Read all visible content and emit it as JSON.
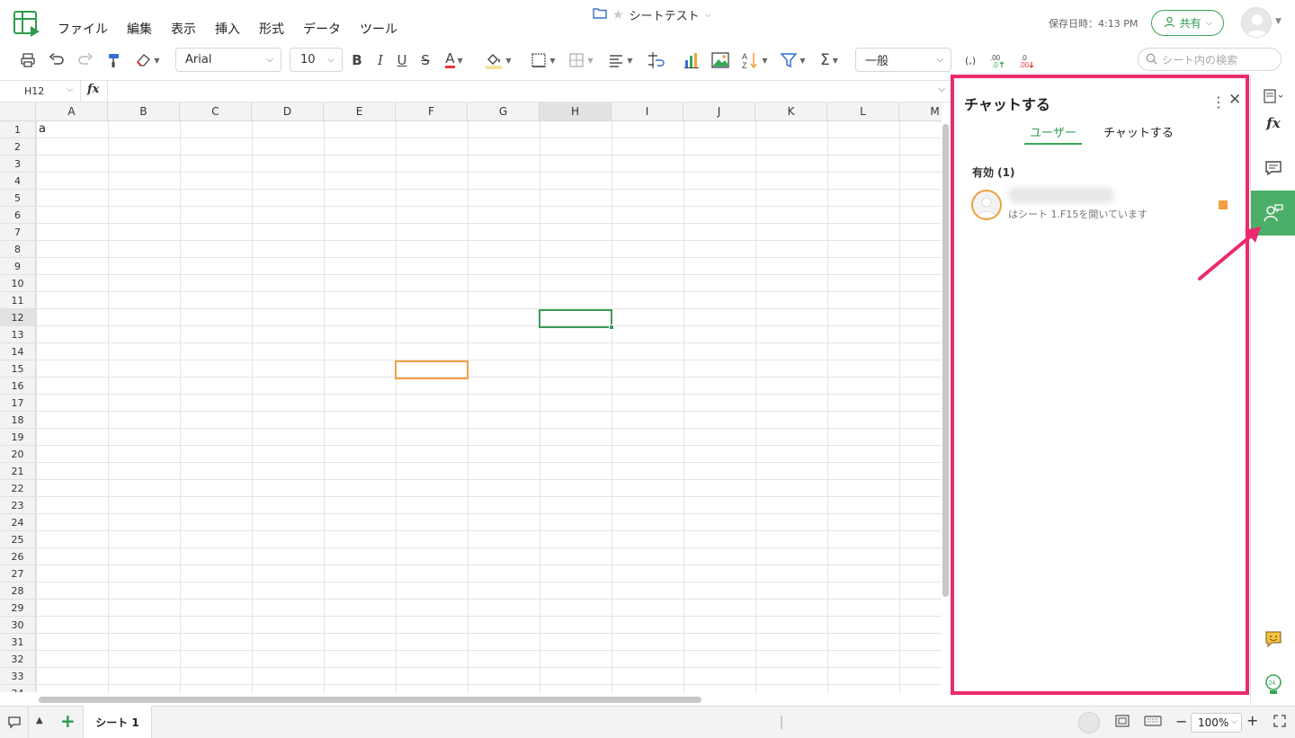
{
  "menu": [
    "ファイル",
    "編集",
    "表示",
    "挿入",
    "形式",
    "データ",
    "ツール"
  ],
  "document": {
    "title": "シートテスト",
    "saved_time": "保存日時：4:13 PM"
  },
  "header": {
    "share_label": "共有"
  },
  "toolbar": {
    "font": "Arial",
    "font_size": "10",
    "bold": "B",
    "italic": "I",
    "underline": "U",
    "strike": "S",
    "font_color_letter": "A",
    "number_format": "一般",
    "search_placeholder": "シート内の検索",
    "accent_color": "#3aa757",
    "font_color": "#e53935"
  },
  "formula_bar": {
    "cell_ref": "H12",
    "fx": "fx",
    "value": ""
  },
  "grid": {
    "columns": [
      "A",
      "B",
      "C",
      "D",
      "E",
      "F",
      "G",
      "H",
      "I",
      "J",
      "K",
      "L",
      "M"
    ],
    "rows": [
      "1",
      "2",
      "3",
      "4",
      "5",
      "6",
      "7",
      "8",
      "9",
      "10",
      "11",
      "12",
      "13",
      "14",
      "15",
      "16",
      "17",
      "18",
      "19",
      "20",
      "21",
      "22",
      "23",
      "24",
      "25",
      "26",
      "27",
      "28",
      "29",
      "30",
      "31",
      "32",
      "33",
      "34"
    ],
    "active_column": "H",
    "active_row": "12",
    "cells": {
      "A1": "a"
    }
  },
  "sheet_tabs": [
    "シート 1"
  ],
  "zoom": "100%",
  "chat_panel": {
    "title": "チャットする",
    "tabs": [
      "ユーザー",
      "チャットする"
    ],
    "active_section": "有効 (1)",
    "user_status": "はシート 1.F15を開いています",
    "highlight_color": "#ea2a6c"
  }
}
